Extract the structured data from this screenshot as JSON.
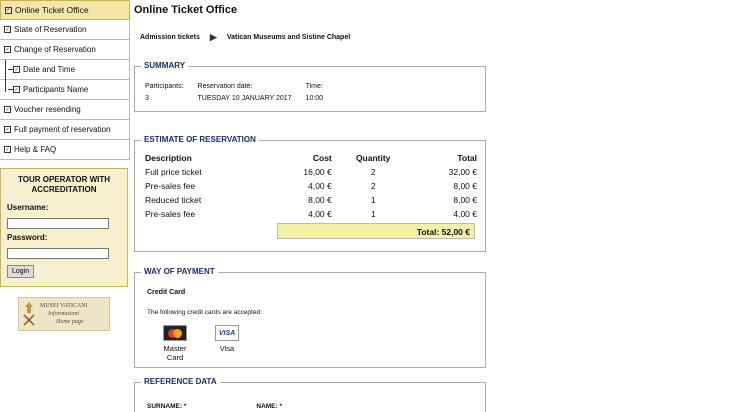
{
  "sidebar": {
    "items": [
      {
        "label": "Online Ticket Office",
        "active": true
      },
      {
        "label": "State of Reservation"
      },
      {
        "label": "Change of Reservation"
      },
      {
        "label": "Date and Time",
        "sub": true
      },
      {
        "label": "Participants Name",
        "sub": true
      },
      {
        "label": "Voucher resending"
      },
      {
        "label": "Full payment of reservation"
      },
      {
        "label": "Help & FAQ"
      }
    ],
    "operator": {
      "title": "TOUR OPERATOR WITH ACCREDITATION",
      "username_label": "Username:",
      "password_label": "Password:",
      "login_label": "Login"
    },
    "logo": {
      "line1": "MUSEI VATICANI",
      "line2": "Informazioni",
      "line3": "Home page"
    }
  },
  "main": {
    "title": "Online Ticket Office",
    "breadcrumb": {
      "first": "Admission tickets",
      "second": "Vatican Museums and Sistine Chapel"
    },
    "summary": {
      "legend": "SUMMARY",
      "participants_label": "Participants:",
      "participants_value": "3",
      "date_label": "Reservation date:",
      "date_value": "TUESDAY 10 JANUARY 2017",
      "time_label": "Time:",
      "time_value": "10:00"
    },
    "estimate": {
      "legend": "ESTIMATE OF RESERVATION",
      "headers": {
        "description": "Description",
        "cost": "Cost",
        "quantity": "Quantity",
        "total": "Total"
      },
      "rows": [
        {
          "description": "Full price ticket",
          "cost": "16,00 €",
          "quantity": "2",
          "total": "32,00 €"
        },
        {
          "description": "Pre-sales fee",
          "cost": "4,00 €",
          "quantity": "2",
          "total": "8,00 €"
        },
        {
          "description": "Reduced ticket",
          "cost": "8,00 €",
          "quantity": "1",
          "total": "8,00 €"
        },
        {
          "description": "Pre-sales fee",
          "cost": "4,00 €",
          "quantity": "1",
          "total": "4,00 €"
        }
      ],
      "total": "Total: 52,00 €"
    },
    "payment": {
      "legend": "WAY OF PAYMENT",
      "title": "Credit Card",
      "text": "The following credit cards are accepted:",
      "cards": {
        "mastercard_line1": "Master",
        "mastercard_line2": "Card",
        "visa": "Visa",
        "visa_logo": "VISA"
      }
    },
    "reference": {
      "legend": "REFERENCE DATA",
      "surname": "SURNAME: *",
      "name": "NAME: *"
    }
  }
}
